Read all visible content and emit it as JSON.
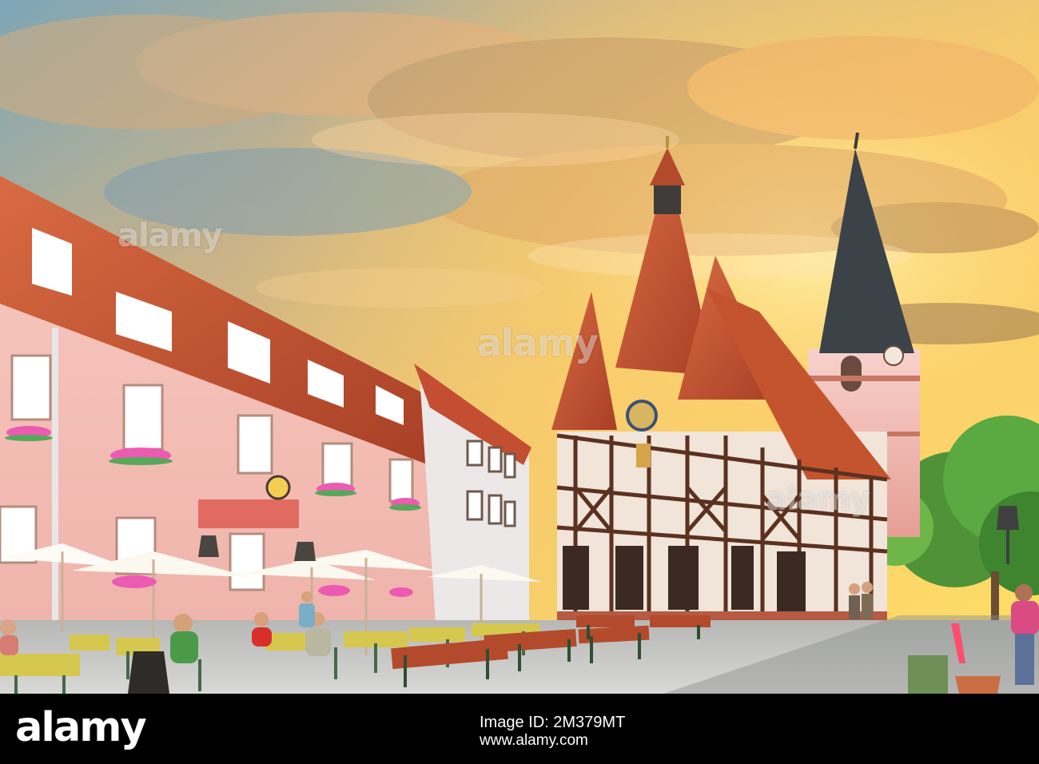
{
  "image": {
    "scene": "half-timbered town hall and church in an old town square",
    "colors": {
      "footer_bg": "#000000",
      "footer_text": "#ffffff",
      "sky_warm": "#f5c56d",
      "sky_cool": "#5f8fa0",
      "roof_red": "#c6502d",
      "facade_pink": "#f4c6be",
      "timber_brown": "#6b3a24",
      "tree_green": "#55a33b",
      "cobble_gray": "#a7a7a5"
    },
    "watermark": {
      "main": "alamy",
      "top_left": "alamy",
      "bottom_right": "alamy"
    }
  },
  "footer": {
    "logo": "alamy",
    "line1": "Image ID: 2M379MT",
    "line2": "www.alamy.com"
  }
}
